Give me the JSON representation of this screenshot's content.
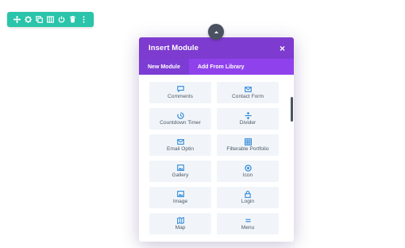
{
  "toolbar": {
    "buttons": [
      {
        "icon": "move-icon"
      },
      {
        "icon": "gear-icon"
      },
      {
        "icon": "duplicate-icon"
      },
      {
        "icon": "columns-icon"
      },
      {
        "icon": "power-icon"
      },
      {
        "icon": "trash-icon"
      },
      {
        "icon": "more-icon"
      }
    ],
    "color": "#29c4a9"
  },
  "modal": {
    "title": "Insert Module",
    "close_symbol": "×",
    "header_color": "#7e3bd0",
    "tabs": [
      {
        "label": "New Module",
        "active": true
      },
      {
        "label": "Add From Library",
        "active": false
      }
    ],
    "modules": [
      {
        "label": "Comments",
        "icon": "comment-icon"
      },
      {
        "label": "Contact Form",
        "icon": "email-icon"
      },
      {
        "label": "Countdown Timer",
        "icon": "timer-icon"
      },
      {
        "label": "Divider",
        "icon": "divider-icon"
      },
      {
        "label": "Email Optin",
        "icon": "email-icon"
      },
      {
        "label": "Filterable Portfolio",
        "icon": "grid-icon"
      },
      {
        "label": "Gallery",
        "icon": "image-icon"
      },
      {
        "label": "Icon",
        "icon": "circle-icon"
      },
      {
        "label": "Image",
        "icon": "image-icon"
      },
      {
        "label": "Login",
        "icon": "lock-icon"
      },
      {
        "label": "Map",
        "icon": "map-icon"
      },
      {
        "label": "Menu",
        "icon": "menu-icon"
      }
    ]
  },
  "accent_icon_color": "#2b87da"
}
